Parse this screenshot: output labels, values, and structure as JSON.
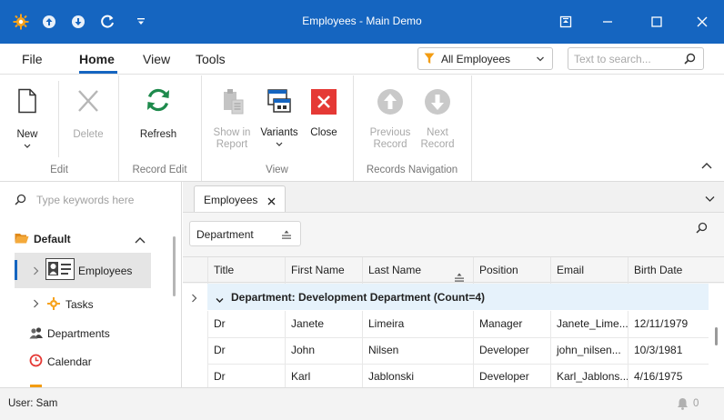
{
  "window": {
    "title": "Employees - Main Demo"
  },
  "menu": {
    "items": [
      "File",
      "Home",
      "View",
      "Tools"
    ],
    "active": "Home"
  },
  "filter": {
    "value": "All Employees"
  },
  "search": {
    "placeholder": "Text to search..."
  },
  "ribbon": {
    "new_label": "New",
    "delete_label": "Delete",
    "refresh_label": "Refresh",
    "show_in_report_label_1": "Show in",
    "show_in_report_label_2": "Report",
    "variants_label": "Variants",
    "close_label": "Close",
    "previous_record_label_1": "Previous",
    "previous_record_label_2": "Record",
    "next_record_label_1": "Next",
    "next_record_label_2": "Record",
    "groups": [
      "Edit",
      "Record Edit",
      "View",
      "Records Navigation"
    ]
  },
  "nav": {
    "search_placeholder": "Type keywords here",
    "group_title": "Default",
    "items": [
      "Employees",
      "Tasks",
      "Departments",
      "Calendar"
    ]
  },
  "tabs": {
    "active": "Employees"
  },
  "grid": {
    "group_by": "Department",
    "columns": [
      "Title",
      "First Name",
      "Last Name",
      "Position",
      "Email",
      "Birth Date"
    ],
    "group_row": "Department: Development Department (Count=4)",
    "rows": [
      [
        "Dr",
        "Janete",
        "Limeira",
        "Manager",
        "Janete_Lime...",
        "12/11/1979"
      ],
      [
        "Dr",
        "John",
        "Nilsen",
        "Developer",
        "john_nilsen...",
        "10/3/1981"
      ],
      [
        "Dr",
        "Karl",
        "Jablonski",
        "Developer",
        "Karl_Jablons...",
        "4/16/1975"
      ]
    ]
  },
  "status": {
    "user": "User: Sam",
    "notifications": "0"
  },
  "colors": {
    "accent": "#1565c0",
    "close_red": "#e53935",
    "refresh_green": "#1e8a4c",
    "group_row": "#e6f2fb"
  }
}
